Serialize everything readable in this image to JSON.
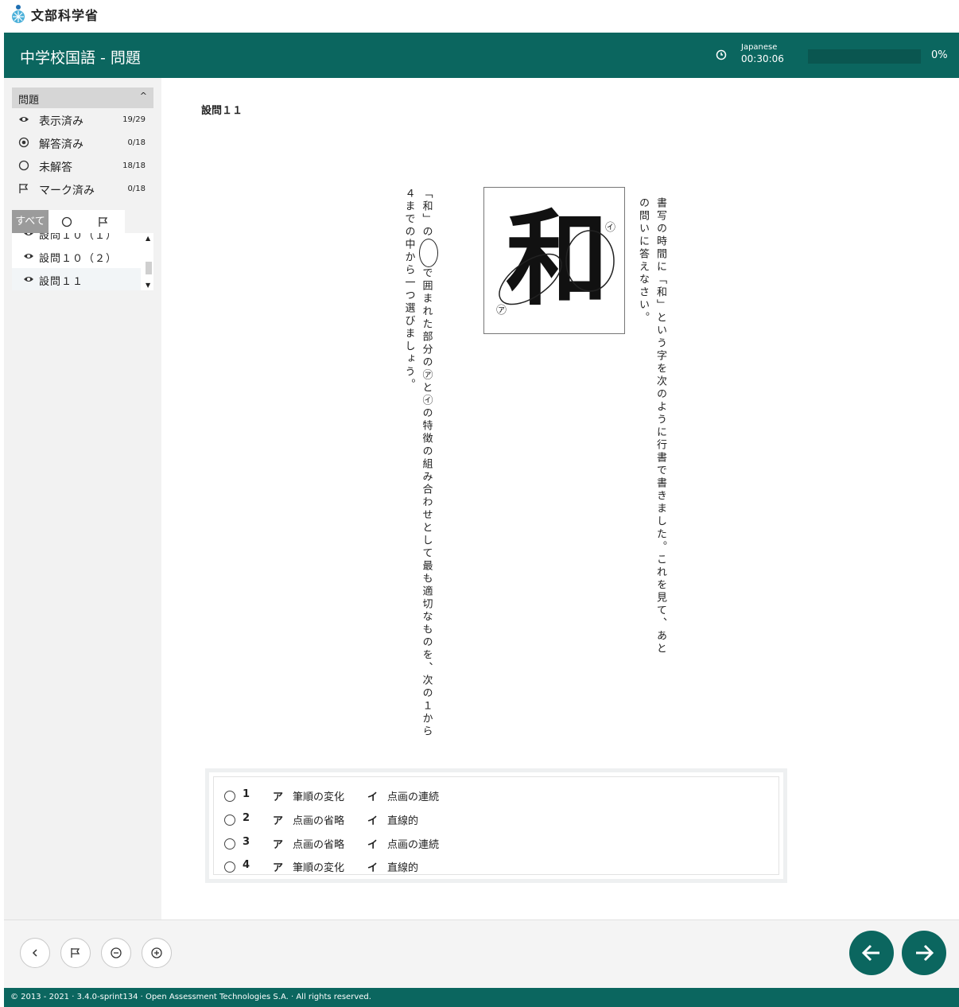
{
  "logo": {
    "text": "文部科学省"
  },
  "header": {
    "title": "中学校国語 - 問題",
    "timer_label": "Japanese",
    "timer_value": "00:30:06",
    "progress_text": "0%",
    "progress_fraction": 0
  },
  "sidebar": {
    "panel_title": "問題",
    "stats": [
      {
        "label": "表示済み",
        "count": "19/29",
        "icon": "eye-icon"
      },
      {
        "label": "解答済み",
        "count": "0/18",
        "icon": "radio-dot-icon"
      },
      {
        "label": "未解答",
        "count": "18/18",
        "icon": "circle-icon"
      },
      {
        "label": "マーク済み",
        "count": "0/18",
        "icon": "flag-icon"
      }
    ],
    "filters": [
      {
        "label": "すべて",
        "icon": ""
      },
      {
        "label": "",
        "icon": "circle-icon"
      },
      {
        "label": "",
        "icon": "flag-icon"
      }
    ],
    "questions": [
      {
        "label": "設問１０（１）"
      },
      {
        "label": "設問１０（２）"
      },
      {
        "label": "設問１１"
      }
    ]
  },
  "question": {
    "title": "設問１１",
    "stem_line1": "書写の時間に「和」という字を次のように行書で書きました。これを見て、あとの問いに答えなさい。",
    "stem_line2_a": "「和」の",
    "stem_line2_b": "で囲まれた部分の㋐と㋑の特徴の組み合わせとして最も適切なものを、次の１から４までの中から一つ選びましょう。",
    "image": {
      "character": "和",
      "labels": [
        "㋐",
        "㋑"
      ]
    },
    "choices": [
      {
        "num": "1",
        "a_mark": "ア",
        "a_text": "筆順の変化",
        "i_mark": "イ",
        "i_text": "点画の連続"
      },
      {
        "num": "2",
        "a_mark": "ア",
        "a_text": "点画の省略",
        "i_mark": "イ",
        "i_text": "直線的"
      },
      {
        "num": "3",
        "a_mark": "ア",
        "a_text": "点画の省略",
        "i_mark": "イ",
        "i_text": "点画の連続"
      },
      {
        "num": "4",
        "a_mark": "ア",
        "a_text": "筆順の変化",
        "i_mark": "イ",
        "i_text": "直線的"
      }
    ]
  },
  "footer": {
    "copyright": "© 2013 - 2021 · 3.4.0-sprint134 · Open Assessment Technologies S.A. · All rights reserved."
  },
  "colors": {
    "brand": "#0b665f",
    "sidebar_bg": "#f2f2f2"
  }
}
